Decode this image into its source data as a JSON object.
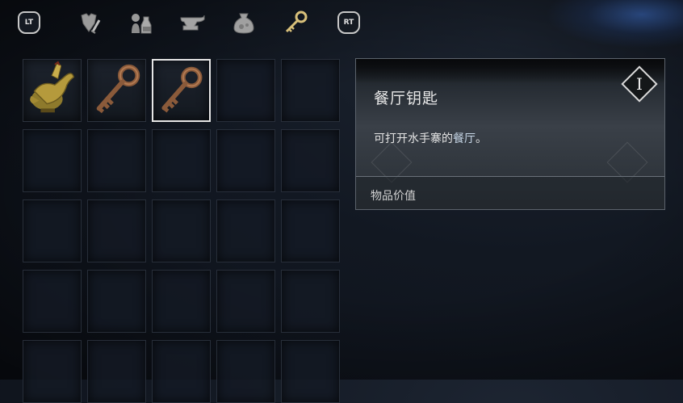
{
  "tabs": {
    "left_trigger": "LT",
    "right_trigger": "RT",
    "categories": [
      {
        "icon": "armor-weapon-icon",
        "active": false
      },
      {
        "icon": "potions-icon",
        "active": false
      },
      {
        "icon": "anvil-icon",
        "active": false
      },
      {
        "icon": "pouch-icon",
        "active": false
      },
      {
        "icon": "key-icon",
        "active": true
      }
    ]
  },
  "inventory": {
    "slots": [
      {
        "item": "golden-bird-statue-icon",
        "selected": false
      },
      {
        "item": "key-icon",
        "selected": false
      },
      {
        "item": "key-icon",
        "selected": true
      }
    ],
    "total_visible_slots": 25
  },
  "detail": {
    "title": "餐厅钥匙",
    "rank": "I",
    "description_prefix": "可打开水手寨的",
    "description_highlight": "餐厅",
    "description_suffix": "。",
    "value_label": "物品价值"
  },
  "colors": {
    "selected_border": "#e6e6e6",
    "key_bronze": "#8a5a3a",
    "statue_gold": "#b59a3c",
    "background": "#121822"
  }
}
